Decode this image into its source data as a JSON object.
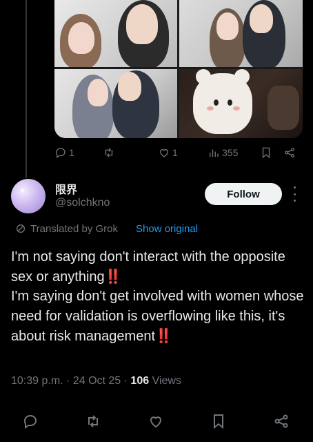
{
  "media_actions": {
    "replies": "1",
    "reposts": "",
    "likes": "1",
    "views": "355"
  },
  "author": {
    "display_name": "限界",
    "handle": "@solchkno",
    "follow_label": "Follow"
  },
  "translation": {
    "label": "Translated by Grok",
    "show_original": "Show original"
  },
  "tweet": {
    "line1": "I'm not saying don't interact with the opposite sex or anything",
    "line2": "I'm saying don't get involved with women whose need for validation is overflowing like this, it's about risk management",
    "emphasis": "‼️"
  },
  "meta": {
    "time": "10:39 p.m.",
    "date": "24 Oct 25",
    "views_count": "106",
    "views_label": "Views"
  },
  "icons": {
    "reply": "reply-icon",
    "repost": "repost-icon",
    "like": "heart-icon",
    "views": "views-icon",
    "bookmark": "bookmark-icon",
    "share": "share-icon",
    "more": "more-icon",
    "translate": "translate-icon"
  },
  "colors": {
    "background": "#000000",
    "text": "#e7e9ea",
    "muted": "#71767b",
    "link": "#1d9bf0",
    "follow_bg": "#eff3f4",
    "emphasis": "#f4212e"
  }
}
